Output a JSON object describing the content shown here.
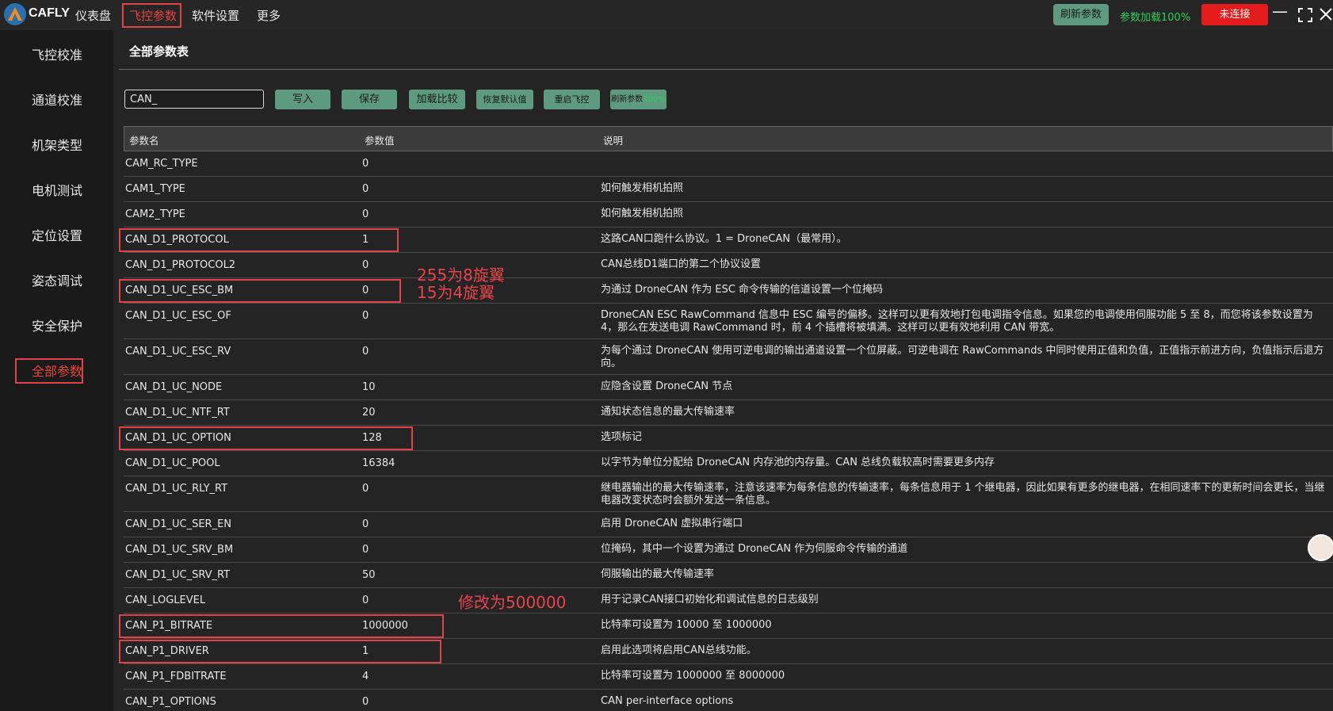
{
  "app": {
    "brand": "CAFLY",
    "nav": [
      "仪表盘",
      "飞控参数",
      "软件设置",
      "更多"
    ],
    "refresh_btn": "刷新参数",
    "progress_text": "参数加载100%",
    "connection_btn": "未连接",
    "colors": {
      "accent_red": "#e8433b",
      "button_green": "#5e9a7f",
      "progress_green": "#2fce54",
      "annotation_red": "#e0424a"
    }
  },
  "sidebar": {
    "items": [
      "飞控校准",
      "通道校准",
      "机架类型",
      "电机测试",
      "定位设置",
      "姿态调试",
      "安全保护",
      "全部参数"
    ],
    "active_index": 7
  },
  "main": {
    "title": "全部参数表",
    "search_value": "CAN_",
    "buttons": [
      "写入",
      "保存",
      "加载比较",
      "恢复默认值",
      "重启飞控"
    ],
    "refresh_label": "刷新参数",
    "refresh_pct": "100%",
    "columns": [
      "参数名",
      "参数值",
      "说明"
    ],
    "rows": [
      {
        "name": "CAM_RC_TYPE",
        "value": "0",
        "desc": ""
      },
      {
        "name": "CAM1_TYPE",
        "value": "0",
        "desc": "如何触发相机拍照"
      },
      {
        "name": "CAM2_TYPE",
        "value": "0",
        "desc": "如何触发相机拍照"
      },
      {
        "name": "CAN_D1_PROTOCOL",
        "value": "1",
        "desc": "这路CAN口跑什么协议。1 = DroneCAN（最常用）。"
      },
      {
        "name": "CAN_D1_PROTOCOL2",
        "value": "0",
        "desc": "CAN总线D1端口的第二个协议设置"
      },
      {
        "name": "CAN_D1_UC_ESC_BM",
        "value": "0",
        "desc": "为通过 DroneCAN 作为 ESC 命令传输的信道设置一个位掩码"
      },
      {
        "name": "CAN_D1_UC_ESC_OF",
        "value": "0",
        "desc": "DroneCAN ESC RawCommand 信息中 ESC 编号的偏移。这样可以更有效地打包电调指令信息。如果您的电调使用伺服功能 5 至 8，而您将该参数设置为 4，那么在发送电调 RawCommand 时，前 4 个插槽将被填满。这样可以更有效地利用 CAN 带宽。"
      },
      {
        "name": "CAN_D1_UC_ESC_RV",
        "value": "0",
        "desc": "为每个通过 DroneCAN 使用可逆电调的输出通道设置一个位屏蔽。可逆电调在 RawCommands 中同时使用正值和负值，正值指示前进方向，负值指示后退方向。"
      },
      {
        "name": "CAN_D1_UC_NODE",
        "value": "10",
        "desc": "应隐含设置 DroneCAN 节点"
      },
      {
        "name": "CAN_D1_UC_NTF_RT",
        "value": "20",
        "desc": "通知状态信息的最大传输速率"
      },
      {
        "name": "CAN_D1_UC_OPTION",
        "value": "128",
        "desc": "选项标记"
      },
      {
        "name": "CAN_D1_UC_POOL",
        "value": "16384",
        "desc": "以字节为单位分配给 DroneCAN 内存池的内存量。CAN 总线负载较高时需要更多内存"
      },
      {
        "name": "CAN_D1_UC_RLY_RT",
        "value": "0",
        "desc": "继电器输出的最大传输速率，注意该速率为每条信息的传输速率，每条信息用于 1 个继电器，因此如果有更多的继电器，在相同速率下的更新时间会更长，当继电器改变状态时会额外发送一条信息。"
      },
      {
        "name": "CAN_D1_UC_SER_EN",
        "value": "0",
        "desc": "启用 DroneCAN 虚拟串行端口"
      },
      {
        "name": "CAN_D1_UC_SRV_BM",
        "value": "0",
        "desc": "位掩码，其中一个设置为通过 DroneCAN 作为伺服命令传输的通道"
      },
      {
        "name": "CAN_D1_UC_SRV_RT",
        "value": "50",
        "desc": "伺服输出的最大传输速率"
      },
      {
        "name": "CAN_LOGLEVEL",
        "value": "0",
        "desc": "用于记录CAN接口初始化和调试信息的日志级别"
      },
      {
        "name": "CAN_P1_BITRATE",
        "value": "1000000",
        "desc": "比特率可设置为 10000 至 1000000"
      },
      {
        "name": "CAN_P1_DRIVER",
        "value": "1",
        "desc": "启用此选项将启用CAN总线功能。"
      },
      {
        "name": "CAN_P1_FDBITRATE",
        "value": "4",
        "desc": "比特率可设置为 1000000 至 8000000"
      },
      {
        "name": "CAN_P1_OPTIONS",
        "value": "0",
        "desc": "CAN per-interface options"
      }
    ]
  },
  "annotations": {
    "esc_bm_line1": "255为8旋翼",
    "esc_bm_line2": "15为4旋翼",
    "bitrate_note": "修改为500000"
  }
}
